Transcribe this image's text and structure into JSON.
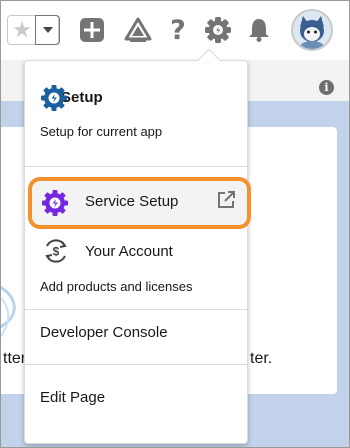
{
  "header": {
    "favorites_star_icon": "star-icon",
    "favorites_menu_icon": "chevron-down-icon",
    "global_actions_icon": "plus-icon",
    "trailhead_icon": "trailhead-icon",
    "help_icon": "question-icon",
    "help_glyph": "?",
    "setup_icon": "gear-icon",
    "notifications_icon": "bell-icon",
    "avatar_icon": "avatar-icon"
  },
  "background": {
    "text_left": "tter",
    "text_right": "ter.",
    "info_glyph": "i"
  },
  "menu": {
    "setup": {
      "label": "Setup",
      "description": "Setup for current app"
    },
    "service_setup": {
      "label": "Service Setup",
      "external_icon": "external-link-icon"
    },
    "your_account": {
      "label": "Your Account",
      "description": "Add products and licenses"
    },
    "developer_console": {
      "label": "Developer Console"
    },
    "edit_page": {
      "label": "Edit Page"
    }
  },
  "colors": {
    "setup_icon": "#1b5f9e",
    "service_icon": "#7526e3",
    "highlight_border": "#f2922c",
    "header_icons": "#747474"
  }
}
